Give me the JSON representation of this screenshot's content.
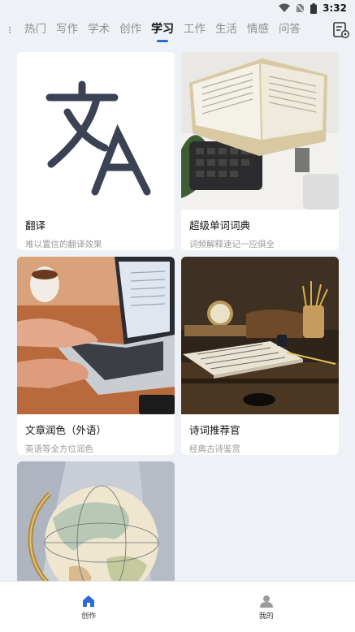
{
  "status": {
    "time": "3:32"
  },
  "tabs": {
    "items": [
      "热门",
      "写作",
      "学术",
      "创作",
      "学习",
      "工作",
      "生活",
      "情感",
      "问答"
    ],
    "active_index": 4,
    "accent": "#2d6bd8"
  },
  "cards": [
    {
      "title": "翻译",
      "desc": "难以置信的翻译效果",
      "icon": "translate-icon"
    },
    {
      "title": "超级单词词典",
      "desc": "词频解释速记一应俱全",
      "icon": "book-photo"
    },
    {
      "title": "文章润色（外语）",
      "desc": "英语等全方位润色",
      "icon": "laptop-photo"
    },
    {
      "title": "诗词推荐官",
      "desc": "经典古诗鉴赏",
      "icon": "desk-photo"
    },
    {
      "title": "",
      "desc": "",
      "icon": "globe-photo"
    }
  ],
  "bottom_nav": {
    "items": [
      {
        "label": "创作",
        "icon": "home-icon",
        "active": true,
        "color": "#2d6bd8"
      },
      {
        "label": "我的",
        "icon": "user-icon",
        "active": false,
        "color": "#9a9a9a"
      }
    ]
  }
}
